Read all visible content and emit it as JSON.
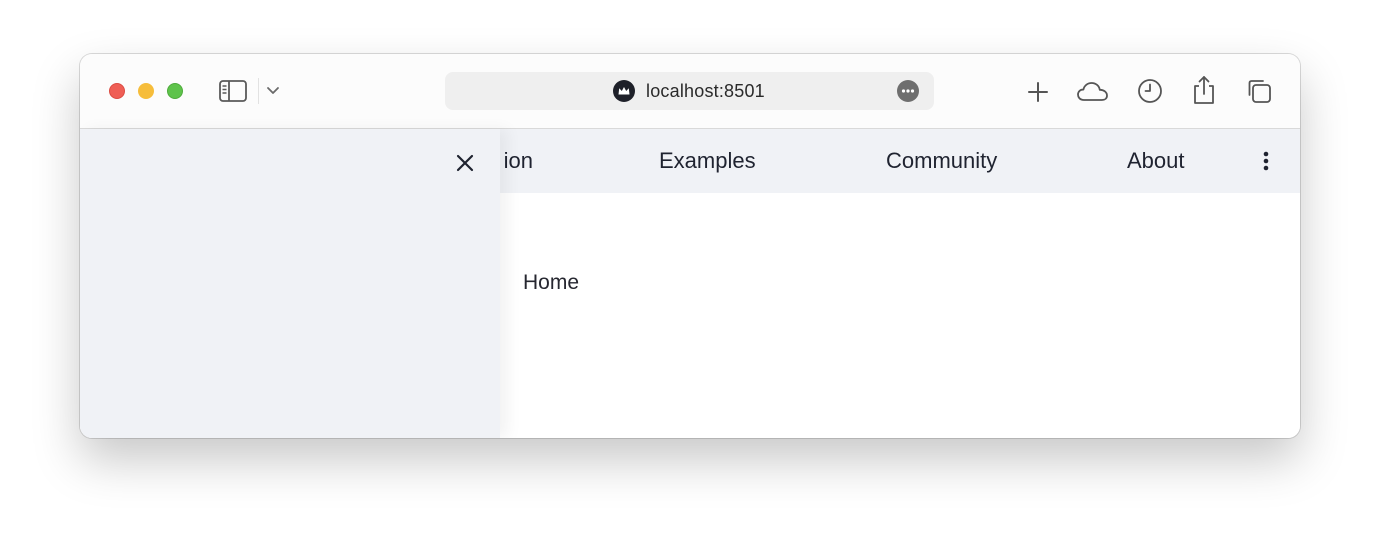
{
  "browser": {
    "url": "localhost:8501",
    "icons": {
      "sidebar": "sidebar-icon",
      "chevron": "chevron-down-icon",
      "site": "streamlit-crown-icon",
      "more": "ellipsis-icon",
      "new_tab": "plus-icon",
      "icloud": "cloud-icon",
      "history": "clock-icon",
      "share": "share-icon",
      "tab_overview": "tabs-icon"
    }
  },
  "app": {
    "nav": {
      "partial": "ion",
      "items": [
        "Examples",
        "Community",
        "About"
      ]
    },
    "home_text": "Home",
    "colors": {
      "nav_bg": "#f0f2f6",
      "drawer_bg": "#f0f2f6",
      "text": "#262730"
    }
  }
}
